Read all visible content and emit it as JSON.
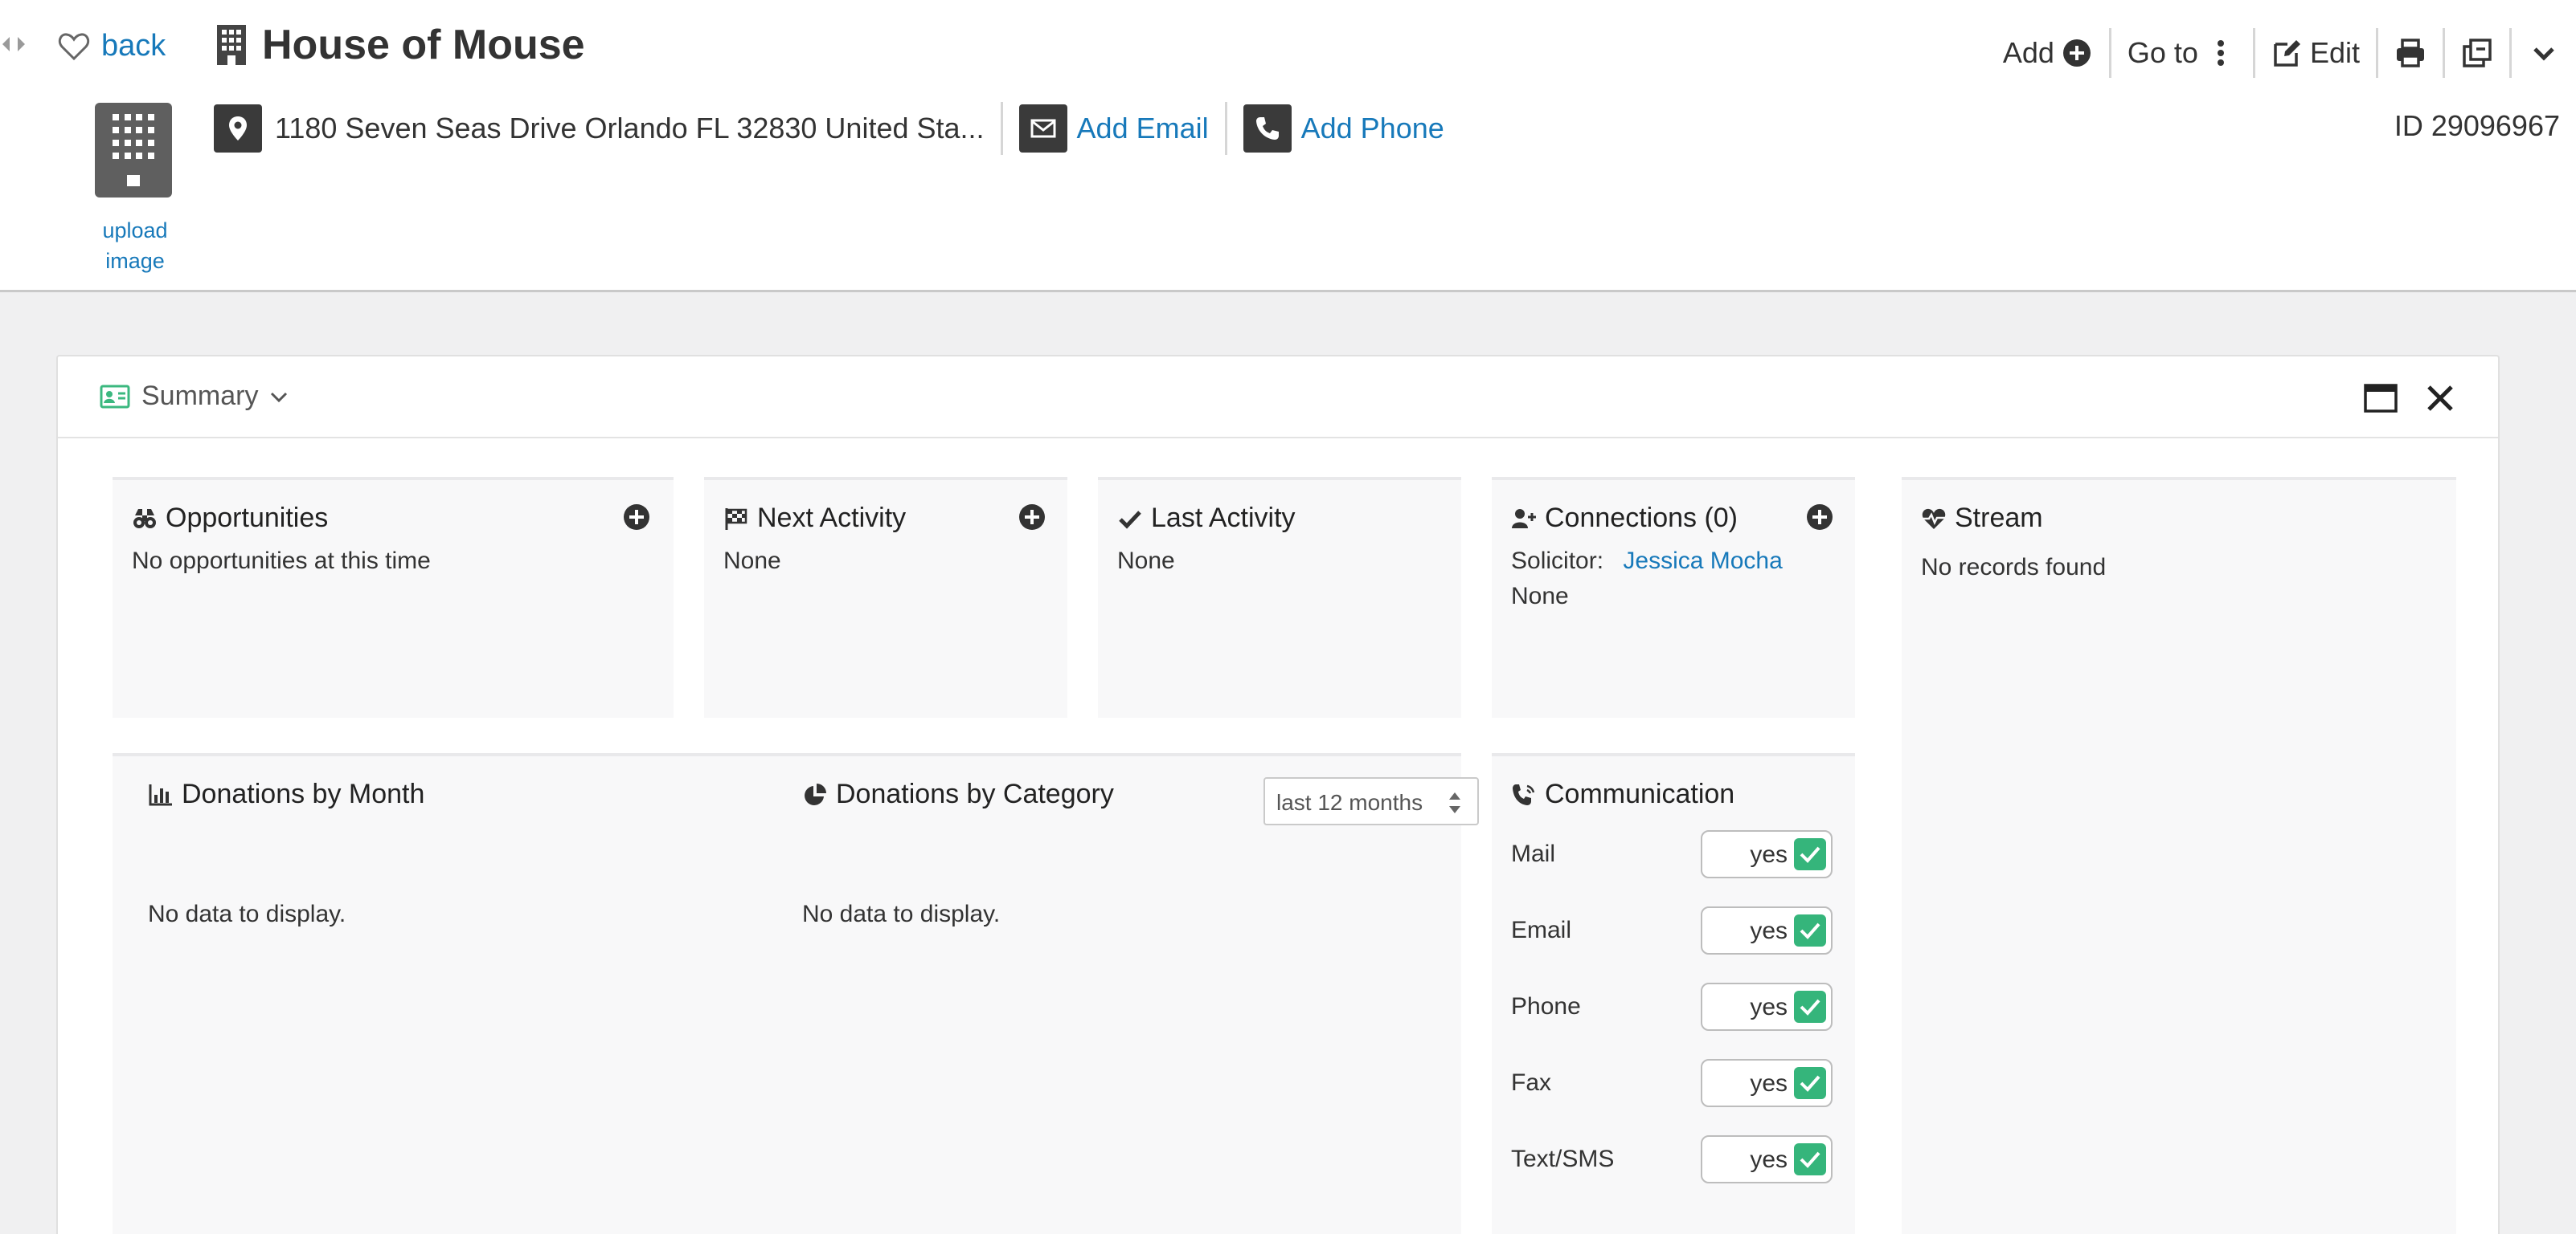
{
  "header": {
    "back_label": "back",
    "title": "House of Mouse",
    "upload_label": "upload image",
    "address": "1180 Seven Seas Drive Orlando  FL 32830  United Sta...",
    "add_email_label": "Add Email",
    "add_phone_label": "Add Phone",
    "record_id": "ID 29096967"
  },
  "toolbar": {
    "add_label": "Add",
    "goto_label": "Go to",
    "edit_label": "Edit"
  },
  "summary": {
    "title": "Summary",
    "opportunities": {
      "title": "Opportunities",
      "text": "No opportunities at this time"
    },
    "next_activity": {
      "title": "Next Activity",
      "text": "None"
    },
    "last_activity": {
      "title": "Last Activity",
      "text": "None"
    },
    "connections": {
      "title": "Connections (0)",
      "solicitor_label": "Solicitor:",
      "solicitor_name": "Jessica Mocha",
      "text": "None"
    },
    "stream": {
      "title": "Stream",
      "text": "No records found"
    },
    "donations_month": {
      "title": "Donations by Month",
      "empty": "No data to display."
    },
    "donations_category": {
      "title": "Donations by Category",
      "empty": "No data to display.",
      "range": "last 12 months"
    },
    "communication": {
      "title": "Communication",
      "rows": [
        {
          "label": "Mail",
          "value": "yes"
        },
        {
          "label": "Email",
          "value": "yes"
        },
        {
          "label": "Phone",
          "value": "yes"
        },
        {
          "label": "Fax",
          "value": "yes"
        },
        {
          "label": "Text/SMS",
          "value": "yes"
        }
      ]
    }
  },
  "colors": {
    "link": "#1779ba",
    "check": "#35b57b",
    "icon_dark": "#3a3a3a"
  }
}
